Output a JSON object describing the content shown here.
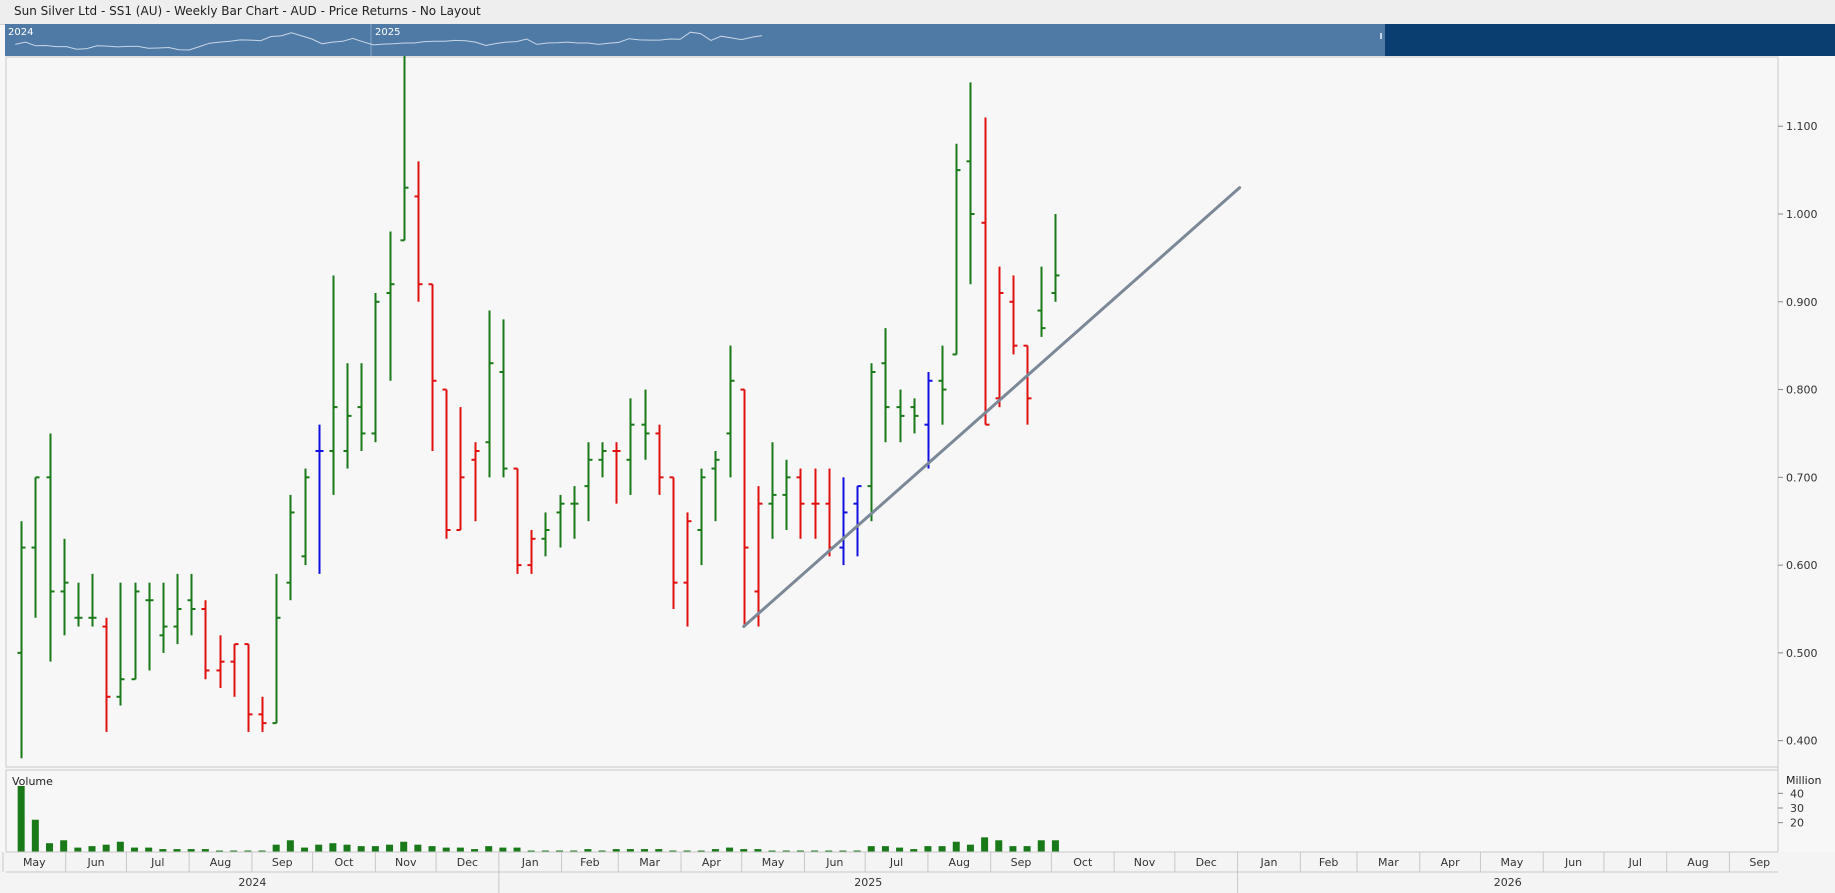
{
  "title": "Sun Silver Ltd - SS1 (AU) - Weekly Bar Chart - AUD - Price Returns - No Layout",
  "navigator": {
    "year_labels": [
      "2024",
      "2025"
    ]
  },
  "volume_panel": {
    "label": "Volume",
    "unit": "Million",
    "ticks": [
      20,
      30,
      40
    ]
  },
  "timeline": {
    "months": [
      "May",
      "Jun",
      "Jul",
      "Aug",
      "Sep",
      "Oct",
      "Nov",
      "Dec",
      "Jan",
      "Feb",
      "Mar",
      "Apr",
      "May",
      "Jun",
      "Jul",
      "Aug",
      "Sep",
      "Oct",
      "Nov",
      "Dec",
      "Jan",
      "Feb",
      "Mar",
      "Apr",
      "May",
      "Jun",
      "Jul",
      "Aug",
      "Sep"
    ],
    "years": [
      "2024",
      "2025",
      "2026"
    ]
  },
  "colors": {
    "up": "#1a7a1a",
    "down": "#e01010",
    "neutral": "#1010e0",
    "trendline": "#7a8898",
    "navigator": "#4f7aa6",
    "navigator_dark": "#0a3d70",
    "volume": "#1a7a1a"
  },
  "chart_data": {
    "type": "ohlc",
    "y_ticks": [
      "1.100",
      "1.000",
      "0.900",
      "0.800",
      "0.700",
      "0.600",
      "0.500",
      "0.400"
    ],
    "ylim": [
      0.37,
      1.18
    ],
    "volume_ylim": [
      0,
      45
    ],
    "x_range": [
      "2024-05-03",
      "2026-09-25"
    ],
    "bars": [
      {
        "date": "2024-05-10",
        "o": 0.5,
        "h": 0.65,
        "l": 0.38,
        "c": 0.62,
        "v": 45,
        "color": "up"
      },
      {
        "date": "2024-05-17",
        "o": 0.62,
        "h": 0.7,
        "l": 0.54,
        "c": 0.7,
        "v": 22,
        "color": "up"
      },
      {
        "date": "2024-05-24",
        "o": 0.7,
        "h": 0.75,
        "l": 0.49,
        "c": 0.57,
        "v": 6,
        "color": "up"
      },
      {
        "date": "2024-05-31",
        "o": 0.57,
        "h": 0.63,
        "l": 0.52,
        "c": 0.58,
        "v": 8,
        "color": "up"
      },
      {
        "date": "2024-06-07",
        "o": 0.54,
        "h": 0.58,
        "l": 0.53,
        "c": 0.54,
        "v": 3,
        "color": "up"
      },
      {
        "date": "2024-06-14",
        "o": 0.54,
        "h": 0.59,
        "l": 0.53,
        "c": 0.54,
        "v": 4,
        "color": "up"
      },
      {
        "date": "2024-06-21",
        "o": 0.53,
        "h": 0.54,
        "l": 0.41,
        "c": 0.45,
        "v": 5,
        "color": "down"
      },
      {
        "date": "2024-06-28",
        "o": 0.45,
        "h": 0.58,
        "l": 0.44,
        "c": 0.47,
        "v": 7,
        "color": "up"
      },
      {
        "date": "2024-07-05",
        "o": 0.47,
        "h": 0.58,
        "l": 0.47,
        "c": 0.57,
        "v": 3,
        "color": "up"
      },
      {
        "date": "2024-07-12",
        "o": 0.56,
        "h": 0.58,
        "l": 0.48,
        "c": 0.56,
        "v": 3,
        "color": "up"
      },
      {
        "date": "2024-07-19",
        "o": 0.52,
        "h": 0.58,
        "l": 0.5,
        "c": 0.53,
        "v": 2,
        "color": "up"
      },
      {
        "date": "2024-07-26",
        "o": 0.53,
        "h": 0.59,
        "l": 0.51,
        "c": 0.55,
        "v": 2,
        "color": "up"
      },
      {
        "date": "2024-08-02",
        "o": 0.56,
        "h": 0.59,
        "l": 0.52,
        "c": 0.55,
        "v": 2,
        "color": "up"
      },
      {
        "date": "2024-08-09",
        "o": 0.55,
        "h": 0.56,
        "l": 0.47,
        "c": 0.48,
        "v": 2,
        "color": "down"
      },
      {
        "date": "2024-08-16",
        "o": 0.48,
        "h": 0.52,
        "l": 0.46,
        "c": 0.49,
        "v": 1,
        "color": "down"
      },
      {
        "date": "2024-08-23",
        "o": 0.49,
        "h": 0.51,
        "l": 0.45,
        "c": 0.51,
        "v": 1,
        "color": "down"
      },
      {
        "date": "2024-08-30",
        "o": 0.51,
        "h": 0.51,
        "l": 0.41,
        "c": 0.43,
        "v": 1,
        "color": "down"
      },
      {
        "date": "2024-09-06",
        "o": 0.43,
        "h": 0.45,
        "l": 0.41,
        "c": 0.42,
        "v": 1,
        "color": "down"
      },
      {
        "date": "2024-09-13",
        "o": 0.42,
        "h": 0.59,
        "l": 0.42,
        "c": 0.54,
        "v": 5,
        "color": "up"
      },
      {
        "date": "2024-09-20",
        "o": 0.58,
        "h": 0.68,
        "l": 0.56,
        "c": 0.66,
        "v": 8,
        "color": "up"
      },
      {
        "date": "2024-09-27",
        "o": 0.61,
        "h": 0.71,
        "l": 0.6,
        "c": 0.7,
        "v": 3,
        "color": "up"
      },
      {
        "date": "2024-10-04",
        "o": 0.73,
        "h": 0.76,
        "l": 0.59,
        "c": 0.73,
        "v": 5,
        "color": "neutral"
      },
      {
        "date": "2024-10-11",
        "o": 0.73,
        "h": 0.93,
        "l": 0.68,
        "c": 0.78,
        "v": 6,
        "color": "up"
      },
      {
        "date": "2024-10-18",
        "o": 0.73,
        "h": 0.83,
        "l": 0.71,
        "c": 0.77,
        "v": 5,
        "color": "up"
      },
      {
        "date": "2024-10-25",
        "o": 0.78,
        "h": 0.83,
        "l": 0.73,
        "c": 0.75,
        "v": 4,
        "color": "up"
      },
      {
        "date": "2024-11-01",
        "o": 0.75,
        "h": 0.91,
        "l": 0.74,
        "c": 0.9,
        "v": 4,
        "color": "up"
      },
      {
        "date": "2024-11-08",
        "o": 0.91,
        "h": 0.98,
        "l": 0.81,
        "c": 0.92,
        "v": 5,
        "color": "up"
      },
      {
        "date": "2024-11-15",
        "o": 0.97,
        "h": 1.18,
        "l": 0.97,
        "c": 1.03,
        "v": 7,
        "color": "up"
      },
      {
        "date": "2024-11-22",
        "o": 1.02,
        "h": 1.06,
        "l": 0.9,
        "c": 0.92,
        "v": 5,
        "color": "down"
      },
      {
        "date": "2024-11-29",
        "o": 0.92,
        "h": 0.92,
        "l": 0.73,
        "c": 0.81,
        "v": 4,
        "color": "down"
      },
      {
        "date": "2024-12-06",
        "o": 0.8,
        "h": 0.8,
        "l": 0.63,
        "c": 0.64,
        "v": 3,
        "color": "down"
      },
      {
        "date": "2024-12-13",
        "o": 0.64,
        "h": 0.78,
        "l": 0.64,
        "c": 0.7,
        "v": 3,
        "color": "down"
      },
      {
        "date": "2024-12-20",
        "o": 0.72,
        "h": 0.74,
        "l": 0.65,
        "c": 0.73,
        "v": 2,
        "color": "down"
      },
      {
        "date": "2024-12-27",
        "o": 0.74,
        "h": 0.89,
        "l": 0.7,
        "c": 0.83,
        "v": 4,
        "color": "up"
      },
      {
        "date": "2025-01-03",
        "o": 0.82,
        "h": 0.88,
        "l": 0.7,
        "c": 0.71,
        "v": 3,
        "color": "up"
      },
      {
        "date": "2025-01-10",
        "o": 0.71,
        "h": 0.71,
        "l": 0.59,
        "c": 0.6,
        "v": 3,
        "color": "down"
      },
      {
        "date": "2025-01-17",
        "o": 0.6,
        "h": 0.64,
        "l": 0.59,
        "c": 0.63,
        "v": 1,
        "color": "down"
      },
      {
        "date": "2025-01-24",
        "o": 0.63,
        "h": 0.66,
        "l": 0.61,
        "c": 0.64,
        "v": 1,
        "color": "up"
      },
      {
        "date": "2025-01-31",
        "o": 0.66,
        "h": 0.68,
        "l": 0.62,
        "c": 0.67,
        "v": 1,
        "color": "up"
      },
      {
        "date": "2025-02-07",
        "o": 0.67,
        "h": 0.69,
        "l": 0.63,
        "c": 0.67,
        "v": 1,
        "color": "up"
      },
      {
        "date": "2025-02-14",
        "o": 0.69,
        "h": 0.74,
        "l": 0.65,
        "c": 0.72,
        "v": 2,
        "color": "up"
      },
      {
        "date": "2025-02-21",
        "o": 0.72,
        "h": 0.74,
        "l": 0.7,
        "c": 0.73,
        "v": 1,
        "color": "up"
      },
      {
        "date": "2025-02-28",
        "o": 0.73,
        "h": 0.74,
        "l": 0.67,
        "c": 0.73,
        "v": 2,
        "color": "down"
      },
      {
        "date": "2025-03-07",
        "o": 0.72,
        "h": 0.79,
        "l": 0.68,
        "c": 0.76,
        "v": 2,
        "color": "up"
      },
      {
        "date": "2025-03-14",
        "o": 0.76,
        "h": 0.8,
        "l": 0.72,
        "c": 0.75,
        "v": 2,
        "color": "up"
      },
      {
        "date": "2025-03-21",
        "o": 0.75,
        "h": 0.76,
        "l": 0.68,
        "c": 0.7,
        "v": 2,
        "color": "down"
      },
      {
        "date": "2025-03-28",
        "o": 0.7,
        "h": 0.7,
        "l": 0.55,
        "c": 0.58,
        "v": 1,
        "color": "down"
      },
      {
        "date": "2025-04-04",
        "o": 0.58,
        "h": 0.66,
        "l": 0.53,
        "c": 0.65,
        "v": 1,
        "color": "down"
      },
      {
        "date": "2025-04-11",
        "o": 0.64,
        "h": 0.71,
        "l": 0.6,
        "c": 0.7,
        "v": 1,
        "color": "up"
      },
      {
        "date": "2025-04-18",
        "o": 0.71,
        "h": 0.73,
        "l": 0.65,
        "c": 0.72,
        "v": 2,
        "color": "up"
      },
      {
        "date": "2025-04-25",
        "o": 0.75,
        "h": 0.85,
        "l": 0.7,
        "c": 0.81,
        "v": 3,
        "color": "up"
      },
      {
        "date": "2025-05-02",
        "o": 0.8,
        "h": 0.8,
        "l": 0.53,
        "c": 0.62,
        "v": 2,
        "color": "down"
      },
      {
        "date": "2025-05-09",
        "o": 0.57,
        "h": 0.69,
        "l": 0.53,
        "c": 0.67,
        "v": 2,
        "color": "down"
      },
      {
        "date": "2025-05-16",
        "o": 0.67,
        "h": 0.74,
        "l": 0.63,
        "c": 0.68,
        "v": 1,
        "color": "up"
      },
      {
        "date": "2025-05-23",
        "o": 0.68,
        "h": 0.72,
        "l": 0.64,
        "c": 0.7,
        "v": 1,
        "color": "up"
      },
      {
        "date": "2025-05-30",
        "o": 0.7,
        "h": 0.71,
        "l": 0.63,
        "c": 0.67,
        "v": 1,
        "color": "down"
      },
      {
        "date": "2025-06-06",
        "o": 0.67,
        "h": 0.71,
        "l": 0.63,
        "c": 0.67,
        "v": 1,
        "color": "down"
      },
      {
        "date": "2025-06-13",
        "o": 0.67,
        "h": 0.71,
        "l": 0.61,
        "c": 0.62,
        "v": 1,
        "color": "down"
      },
      {
        "date": "2025-06-20",
        "o": 0.62,
        "h": 0.7,
        "l": 0.6,
        "c": 0.66,
        "v": 1,
        "color": "neutral"
      },
      {
        "date": "2025-06-27",
        "o": 0.67,
        "h": 0.69,
        "l": 0.61,
        "c": 0.69,
        "v": 1,
        "color": "neutral"
      },
      {
        "date": "2025-07-04",
        "o": 0.69,
        "h": 0.83,
        "l": 0.65,
        "c": 0.82,
        "v": 4,
        "color": "up"
      },
      {
        "date": "2025-07-11",
        "o": 0.83,
        "h": 0.87,
        "l": 0.74,
        "c": 0.78,
        "v": 4,
        "color": "up"
      },
      {
        "date": "2025-07-18",
        "o": 0.78,
        "h": 0.8,
        "l": 0.74,
        "c": 0.77,
        "v": 3,
        "color": "up"
      },
      {
        "date": "2025-07-25",
        "o": 0.78,
        "h": 0.79,
        "l": 0.75,
        "c": 0.77,
        "v": 2,
        "color": "up"
      },
      {
        "date": "2025-08-01",
        "o": 0.76,
        "h": 0.82,
        "l": 0.71,
        "c": 0.81,
        "v": 4,
        "color": "neutral"
      },
      {
        "date": "2025-08-08",
        "o": 0.81,
        "h": 0.85,
        "l": 0.76,
        "c": 0.8,
        "v": 4,
        "color": "up"
      },
      {
        "date": "2025-08-15",
        "o": 0.84,
        "h": 1.08,
        "l": 0.84,
        "c": 1.05,
        "v": 7,
        "color": "up"
      },
      {
        "date": "2025-08-22",
        "o": 1.06,
        "h": 1.15,
        "l": 0.92,
        "c": 1.0,
        "v": 5,
        "color": "up"
      },
      {
        "date": "2025-08-29",
        "o": 0.99,
        "h": 1.11,
        "l": 0.76,
        "c": 0.76,
        "v": 10,
        "color": "down"
      },
      {
        "date": "2025-09-05",
        "o": 0.79,
        "h": 0.94,
        "l": 0.78,
        "c": 0.91,
        "v": 8,
        "color": "down"
      },
      {
        "date": "2025-09-12",
        "o": 0.9,
        "h": 0.93,
        "l": 0.84,
        "c": 0.85,
        "v": 4,
        "color": "down"
      },
      {
        "date": "2025-09-19",
        "o": 0.85,
        "h": 0.85,
        "l": 0.76,
        "c": 0.79,
        "v": 4,
        "color": "down"
      },
      {
        "date": "2025-09-26",
        "o": 0.89,
        "h": 0.94,
        "l": 0.86,
        "c": 0.87,
        "v": 8,
        "color": "up"
      },
      {
        "date": "2025-10-03",
        "o": 0.91,
        "h": 1.0,
        "l": 0.9,
        "c": 0.93,
        "v": 8,
        "color": "up"
      }
    ],
    "trendline": {
      "from": [
        "2025-05-02",
        0.53
      ],
      "to": [
        "2026-01-02",
        1.03
      ]
    }
  }
}
